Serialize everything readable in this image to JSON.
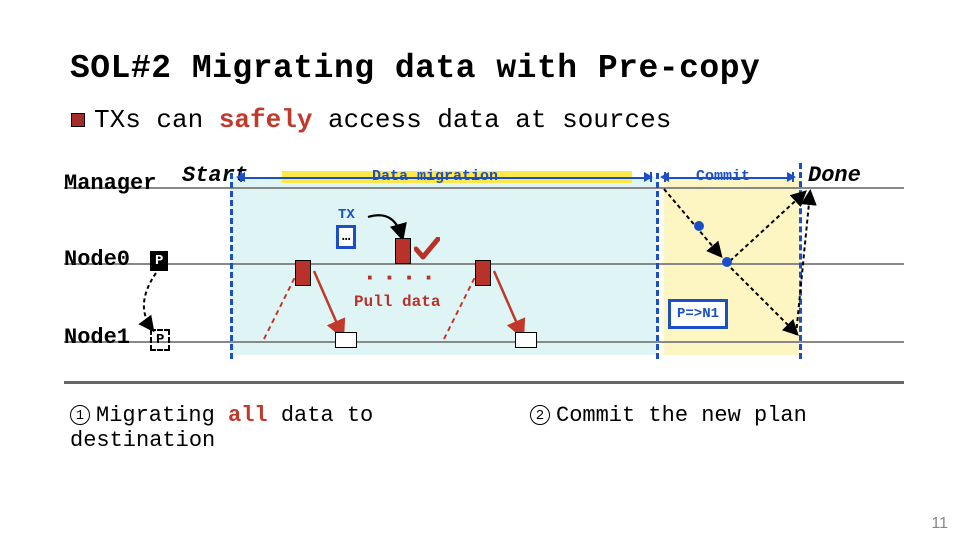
{
  "title": "SOL#2 Migrating data with Pre-copy",
  "bullet": {
    "pre": "TXs can ",
    "em": "safely",
    "post": " access data at sources"
  },
  "rows": {
    "manager": "Manager",
    "node0": "Node0",
    "node1": "Node1"
  },
  "badges": {
    "p_solid": "P",
    "p_dashed": "P"
  },
  "phases": {
    "start": "Start",
    "migration": "Data migration",
    "commit": "Commit",
    "done": "Done"
  },
  "tx": {
    "label": "TX",
    "dots": "…"
  },
  "pull_label": "Pull data",
  "repeat_dots": "····",
  "commit_box": "P=>N1",
  "footnotes": {
    "one": {
      "num": "1",
      "pre": "Migrating ",
      "em": "all",
      "post": " data to destination"
    },
    "two": {
      "num": "2",
      "text": "Commit the new plan"
    }
  },
  "page": "11"
}
